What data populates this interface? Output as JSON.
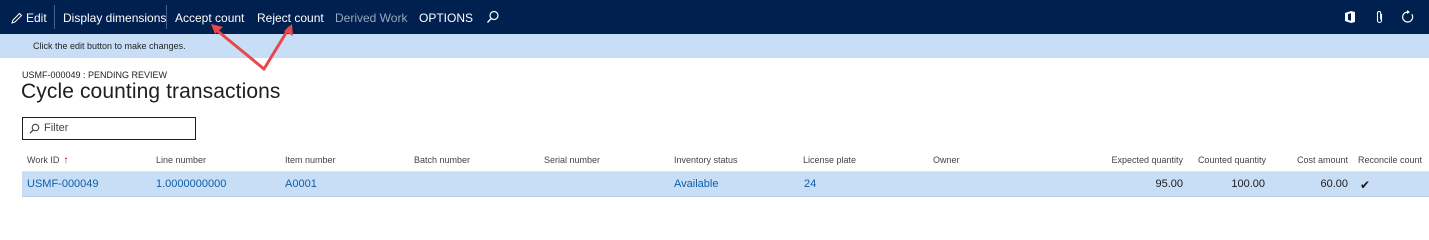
{
  "toolbar": {
    "edit_label": "Edit",
    "display_dimensions_label": "Display dimensions",
    "accept_count_label": "Accept count",
    "reject_count_label": "Reject count",
    "derived_work_label": "Derived Work",
    "options_label": "OPTIONS"
  },
  "infobar": {
    "message": "Click the edit button to make changes."
  },
  "page": {
    "record_caption": "USMF-000049 : PENDING REVIEW",
    "title": "Cycle counting transactions"
  },
  "filter": {
    "placeholder": "Filter"
  },
  "grid": {
    "columns": [
      "Work ID",
      "Line number",
      "Item number",
      "Batch number",
      "Serial number",
      "Inventory status",
      "License plate",
      "Owner",
      "Expected quantity",
      "Counted quantity",
      "Cost amount",
      "Reconcile count"
    ],
    "sort_indicator": "↑",
    "rows": [
      {
        "work_id": "USMF-000049",
        "line_number": "1.0000000000",
        "item_number": "A0001",
        "batch_number": "",
        "serial_number": "",
        "inventory_status": "Available",
        "license_plate": "24",
        "owner": "",
        "expected_quantity": "95.00",
        "counted_quantity": "100.00",
        "cost_amount": "60.00",
        "reconcile_count": "✔"
      }
    ]
  },
  "colors": {
    "toolbar_bg": "#002050",
    "infobar_bg": "#c8def7",
    "selected_row_bg": "#c8def7",
    "link": "#0f5ea8",
    "annotation_arrow": "#e8474c"
  }
}
